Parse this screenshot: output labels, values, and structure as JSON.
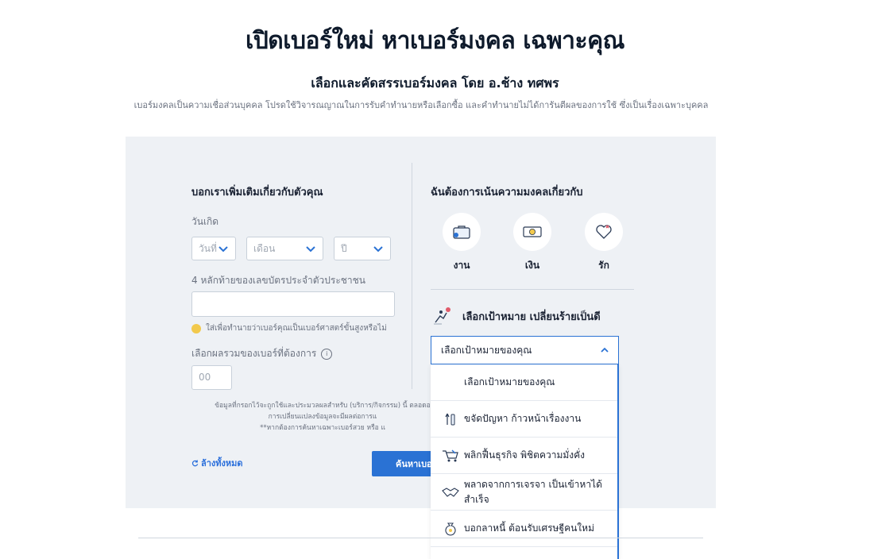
{
  "header": {
    "title": "เปิดเบอร์ใหม่ หาเบอร์มงคล เฉพาะคุณ",
    "subtitle": "เลือกและคัดสรรเบอร์มงคล โดย อ.ช้าง ทศพร",
    "disclaimer": "เบอร์มงคลเป็นความเชื่อส่วนบุคคล โปรดใช้วิจารณญาณในการรับคำทำนายหรือเลือกซื้อ และคำทำนายไม่ได้การันตีผลของการใช้ ซึ่งเป็นเรื่องเฉพาะบุคคล"
  },
  "left": {
    "section_title": "บอกเราเพิ่มเติมเกี่ยวกับตัวคุณ",
    "birthday_label": "วันเกิด",
    "day_placeholder": "วันที่",
    "month_placeholder": "เดือน",
    "year_placeholder": "ปี",
    "id_label": "4 หลักท้ายของเลขบัตรประจำตัวประชาชน",
    "id_value": "",
    "hint": "ใส่เพื่อทำนายว่าเบอร์คุณเป็นเบอร์ศาสตร์ขั้นสูงหรือไม่",
    "sum_label": "เลือกผลรวมของเบอร์ที่ต้องการ",
    "sum_placeholder": "00",
    "consent_line1": "ข้อมูลที่กรอกไว้จะถูกใช้และประมวลผลสำหรับ (บริการ/กิจกรรม) นี้ ตลอดอ",
    "consent_line2": "การเปลี่ยนแปลงข้อมูลจะมีผลต่อการแ",
    "consent_line3": "**หากต้องการค้นหาเฉพาะเบอร์สวย หรือ แ",
    "clear_label": "ล้างทั้งหมด",
    "search_label": "ค้นหาเบอร์"
  },
  "right": {
    "section_title": "ฉันต้องการเน้นความมงคลเกี่ยวกับ",
    "categories": [
      {
        "label": "งาน",
        "icon": "briefcase-icon"
      },
      {
        "label": "เงิน",
        "icon": "money-icon"
      },
      {
        "label": "รัก",
        "icon": "heart-icon"
      }
    ],
    "goal_title": "เลือกเป้าหมาย เปลี่ยนร้ายเป็นดี",
    "goal_selected": "เลือกเป้าหมายของคุณ",
    "goal_options": [
      {
        "label": "เลือกเป้าหมายของคุณ",
        "icon": ""
      },
      {
        "label": "ขจัดปัญหา ก้าวหน้าเรื่องงาน",
        "icon": "tools-icon"
      },
      {
        "label": "พลิกฟื้นธุรกิจ พิชิตความมั่งคั่ง",
        "icon": "cart-icon"
      },
      {
        "label": "พลาดจากการเจรจา เป็นเข้าหาได้สำเร็จ",
        "icon": "handshake-icon"
      },
      {
        "label": "บอกลาหนี้ ต้อนรับเศรษฐีคนใหม่",
        "icon": "money-bag-icon"
      }
    ]
  },
  "colors": {
    "accent": "#2a72d4",
    "panel": "#eef1f5"
  }
}
